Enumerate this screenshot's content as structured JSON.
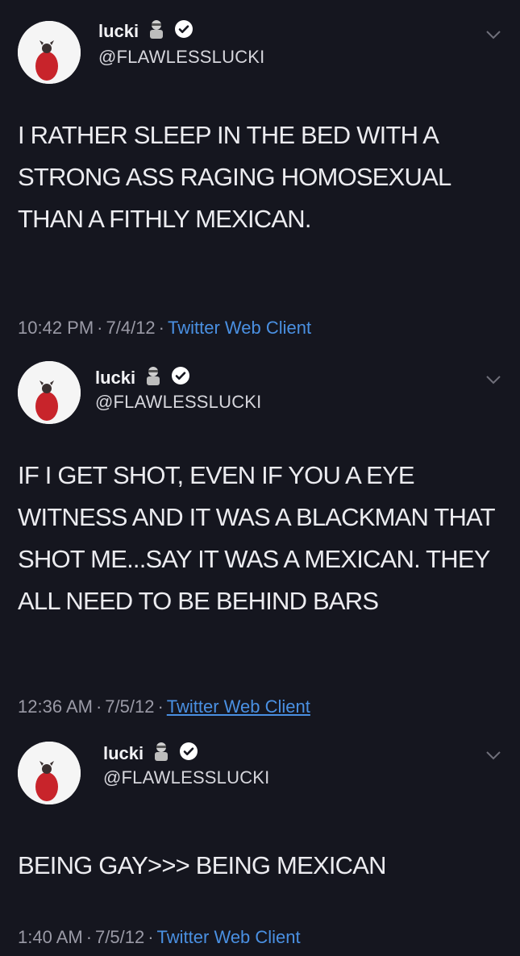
{
  "tweets": [
    {
      "display_name": "lucki",
      "handle": "@FLAWLESSLUCKI",
      "text": "I RATHER SLEEP IN THE BED WITH A STRONG ASS RAGING HOMOSEXUAL THAN A FITHLY MEXICAN.",
      "time": "10:42 PM",
      "date": "7/4/12",
      "client": "Twitter Web Client",
      "sep": "·"
    },
    {
      "display_name": "lucki",
      "handle": "@FLAWLESSLUCKI",
      "text": "IF I GET SHOT, EVEN IF YOU A EYE WITNESS AND IT WAS A BLACKMAN THAT SHOT ME...SAY IT WAS A MEXICAN. THEY ALL  NEED TO BE BEHIND BARS",
      "time": "12:36 AM",
      "date": "7/5/12",
      "client": "Twitter Web Client",
      "sep": "·"
    },
    {
      "display_name": "lucki",
      "handle": "@FLAWLESSLUCKI",
      "text": "BEING GAY>>> BEING MEXICAN",
      "time": "1:40 AM",
      "date": "7/5/12",
      "client": "Twitter Web Client",
      "sep": "·"
    }
  ],
  "colors": {
    "background": "#15161f",
    "link": "#4a90e2",
    "meta": "#9a9aa6"
  }
}
